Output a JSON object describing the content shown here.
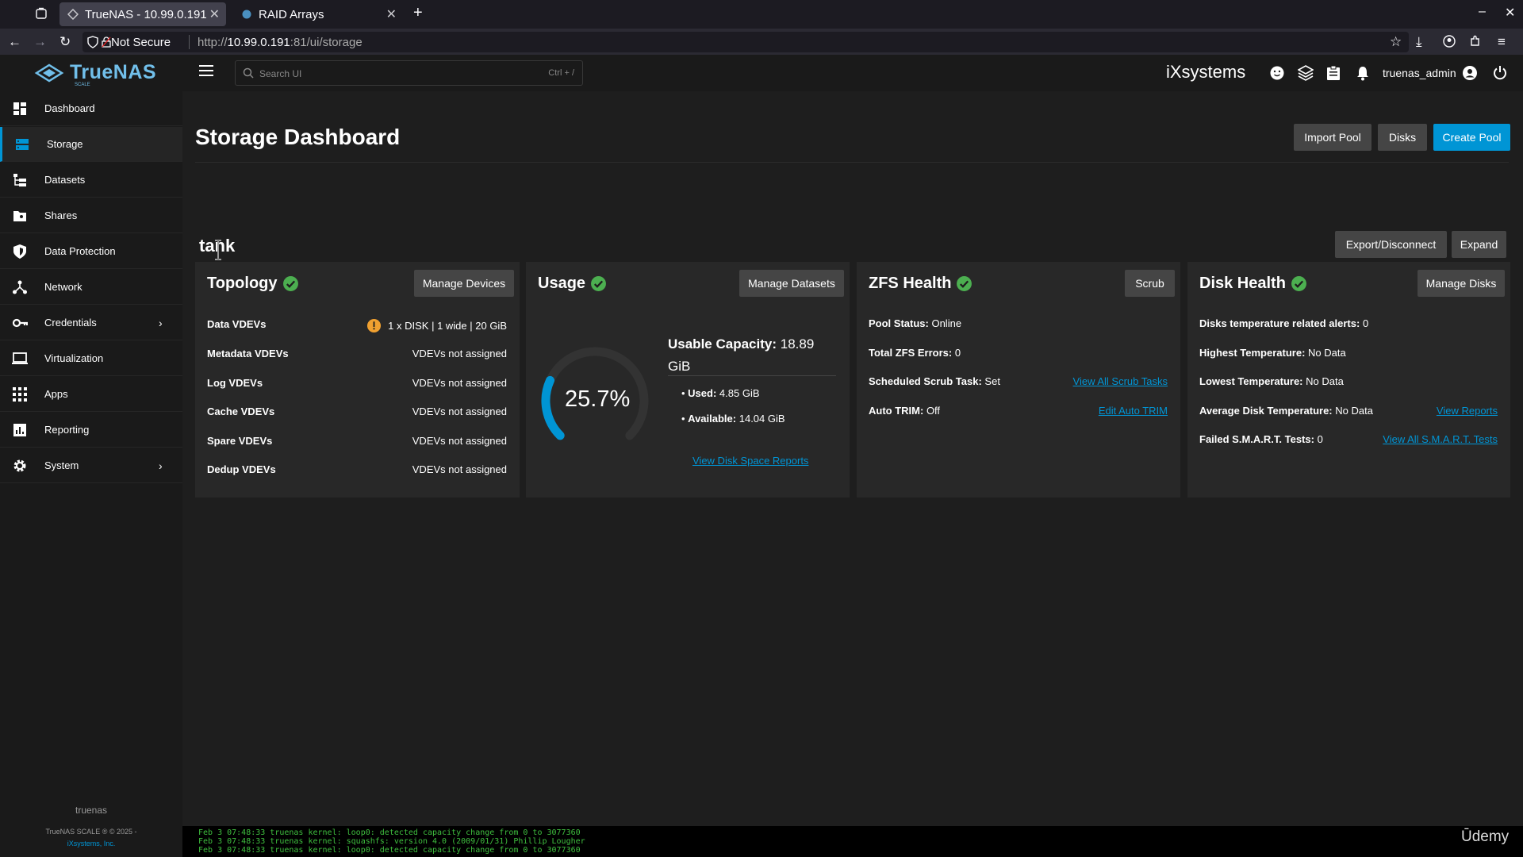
{
  "browser": {
    "tabs": [
      {
        "title": "TrueNAS - 10.99.0.191",
        "active": true
      },
      {
        "title": "RAID Arrays",
        "active": false
      }
    ],
    "not_secure": "Not Secure",
    "url_prefix": "http://",
    "url_host": "10.99.0.191",
    "url_path": ":81/ui/storage"
  },
  "header": {
    "logo": "TrueNAS",
    "logo_sub": "SCALE",
    "search_placeholder": "Search UI",
    "search_shortcut": "Ctrl + /",
    "vendor": "iXsystems",
    "username": "truenas_admin"
  },
  "sidebar": {
    "items": [
      {
        "label": "Dashboard",
        "icon": "dashboard-icon"
      },
      {
        "label": "Storage",
        "icon": "storage-icon",
        "active": true
      },
      {
        "label": "Datasets",
        "icon": "datasets-icon"
      },
      {
        "label": "Shares",
        "icon": "shares-icon"
      },
      {
        "label": "Data Protection",
        "icon": "shield-icon"
      },
      {
        "label": "Network",
        "icon": "network-icon"
      },
      {
        "label": "Credentials",
        "icon": "key-icon",
        "expandable": true
      },
      {
        "label": "Virtualization",
        "icon": "monitor-icon"
      },
      {
        "label": "Apps",
        "icon": "apps-grid-icon"
      },
      {
        "label": "Reporting",
        "icon": "chart-icon"
      },
      {
        "label": "System",
        "icon": "gear-icon",
        "expandable": true
      }
    ],
    "hostname": "truenas",
    "copyright": "TrueNAS SCALE ® © 2025 -",
    "company": "iXsystems, Inc."
  },
  "page": {
    "title": "Storage Dashboard",
    "buttons": {
      "import": "Import Pool",
      "disks": "Disks",
      "create": "Create Pool"
    },
    "pool": {
      "name": "tank",
      "export": "Export/Disconnect",
      "expand": "Expand"
    }
  },
  "topology": {
    "title": "Topology",
    "button": "Manage Devices",
    "rows": [
      {
        "label": "Data VDEVs",
        "value": "1 x DISK | 1 wide | 20 GiB",
        "warning": true
      },
      {
        "label": "Metadata VDEVs",
        "value": "VDEVs not assigned"
      },
      {
        "label": "Log VDEVs",
        "value": "VDEVs not assigned"
      },
      {
        "label": "Cache VDEVs",
        "value": "VDEVs not assigned"
      },
      {
        "label": "Spare VDEVs",
        "value": "VDEVs not assigned"
      },
      {
        "label": "Dedup VDEVs",
        "value": "VDEVs not assigned"
      }
    ]
  },
  "usage": {
    "title": "Usage",
    "button": "Manage Datasets",
    "percent_label": "25.7%",
    "percent": 25.7,
    "capacity_label": "Usable Capacity:",
    "capacity_value": "18.89",
    "capacity_unit": "GiB",
    "used_label": "Used:",
    "used_value": "4.85 GiB",
    "available_label": "Available:",
    "available_value": "14.04 GiB",
    "link": "View Disk Space Reports"
  },
  "zfs": {
    "title": "ZFS Health",
    "button": "Scrub",
    "pool_status_label": "Pool Status:",
    "pool_status": "Online",
    "errors_label": "Total ZFS Errors:",
    "errors": "0",
    "scrub_label": "Scheduled Scrub Task:",
    "scrub": "Set",
    "scrub_link": "View All Scrub Tasks",
    "trim_label": "Auto TRIM:",
    "trim": "Off",
    "trim_link": "Edit Auto TRIM"
  },
  "disk": {
    "title": "Disk Health",
    "button": "Manage Disks",
    "alerts_label": "Disks temperature related alerts:",
    "alerts": "0",
    "highest_label": "Highest Temperature:",
    "highest": "No Data",
    "lowest_label": "Lowest Temperature:",
    "lowest": "No Data",
    "avg_label": "Average Disk Temperature:",
    "avg": "No Data",
    "avg_link": "View Reports",
    "smart_label": "Failed S.M.A.R.T. Tests:",
    "smart": "0",
    "smart_link": "View All S.M.A.R.T. Tests"
  },
  "console": [
    "Feb  3 07:48:33 truenas kernel: loop0: detected capacity change from 0 to 3077360",
    "Feb  3 07:48:33 truenas kernel: squashfs: version 4.0 (2009/01/31) Phillip Lougher",
    "Feb  3 07:48:33 truenas kernel: loop0: detected capacity change from 0 to 3077360"
  ],
  "watermark": "Ūdemy",
  "colors": {
    "accent": "#0095d5",
    "ok": "#4caf50",
    "warn": "#f0a030",
    "gauge_track": "#333333"
  }
}
